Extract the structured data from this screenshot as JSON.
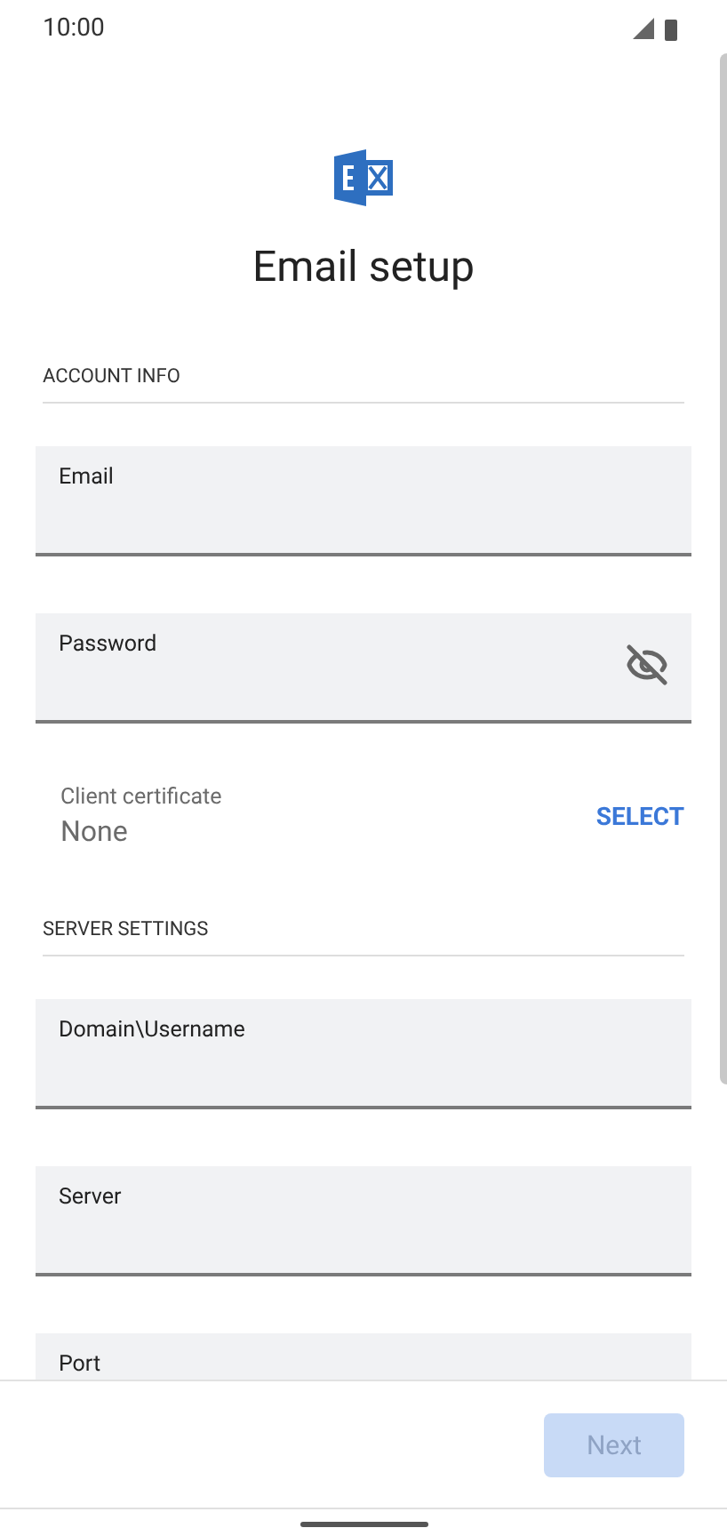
{
  "status_bar": {
    "time": "10:00"
  },
  "title": "Email setup",
  "sections": [
    {
      "heading": "ACCOUNT INFO",
      "items": [
        {
          "kind": "field",
          "label": "Email"
        },
        {
          "kind": "password",
          "label": "Password",
          "visible": false
        },
        {
          "kind": "chooser",
          "label": "Client certificate",
          "value": "None",
          "action": "SELECT"
        }
      ]
    },
    {
      "heading": "SERVER SETTINGS",
      "items": [
        {
          "kind": "field",
          "label": "Domain\\Username"
        },
        {
          "kind": "field",
          "label": "Server"
        },
        {
          "kind": "field",
          "label": "Port"
        }
      ]
    }
  ],
  "next_button": {
    "label": "Next",
    "disabled": true
  }
}
